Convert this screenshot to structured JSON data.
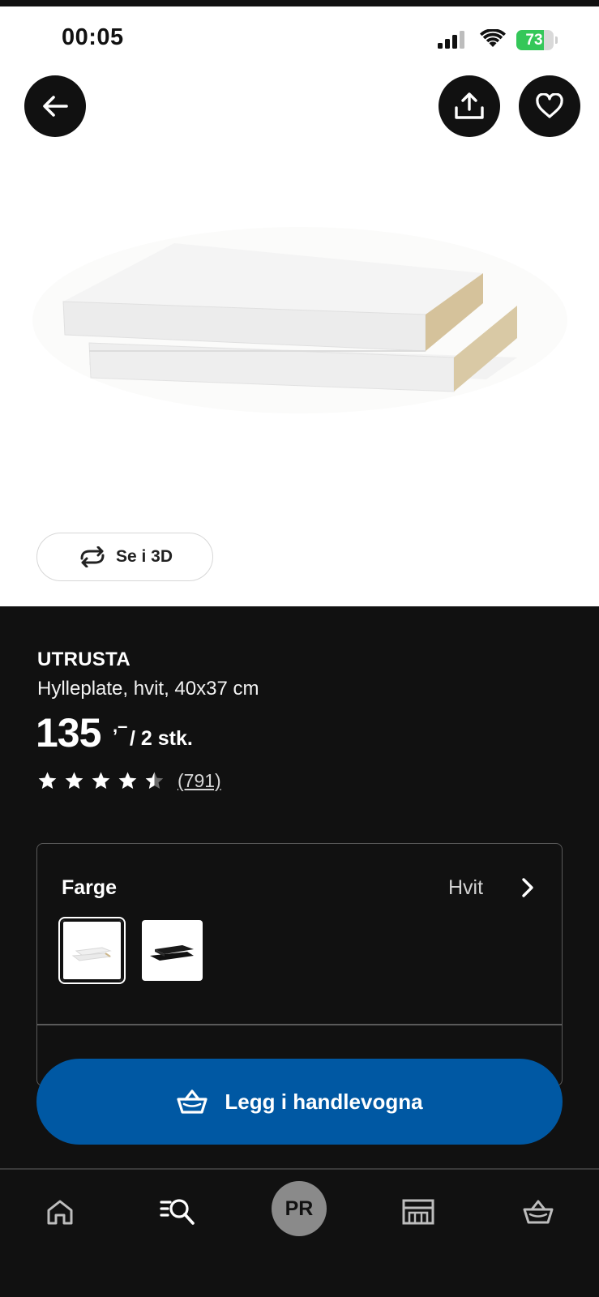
{
  "status_bar": {
    "time": "00:05",
    "battery_percent": "73",
    "battery_level": 0.73,
    "icons": [
      "signal-icon",
      "wifi-icon",
      "battery-icon",
      "charging-bolt-icon"
    ]
  },
  "header": {
    "back_icon": "arrow-left-icon",
    "share_icon": "share-icon",
    "favorite_icon": "heart-icon"
  },
  "view3d": {
    "label": "Se i 3D",
    "icon": "rotate-3d-icon"
  },
  "product": {
    "brand": "UTRUSTA",
    "description": "Hylleplate, hvit, 40x37 cm",
    "price_main": "135",
    "price_decimal": ",–",
    "price_unit": "/ 2 stk.",
    "rating_value": 4.5,
    "rating_max": 5,
    "rating_count": "(791)"
  },
  "color_selector": {
    "title": "Farge",
    "selected_value": "Hvit",
    "options": [
      "white",
      "black"
    ],
    "selected_index": 0
  },
  "cart_button": {
    "label": "Legg i handlevogna",
    "icon": "basket-icon"
  },
  "bottom_nav": {
    "items": [
      "home-icon",
      "search-list-icon",
      "profile-avatar",
      "store-icon",
      "cart-icon"
    ],
    "profile_initials": "PR"
  },
  "colors": {
    "background": "#111111",
    "accent_blue": "#0058a3",
    "battery_green": "#34c759"
  }
}
